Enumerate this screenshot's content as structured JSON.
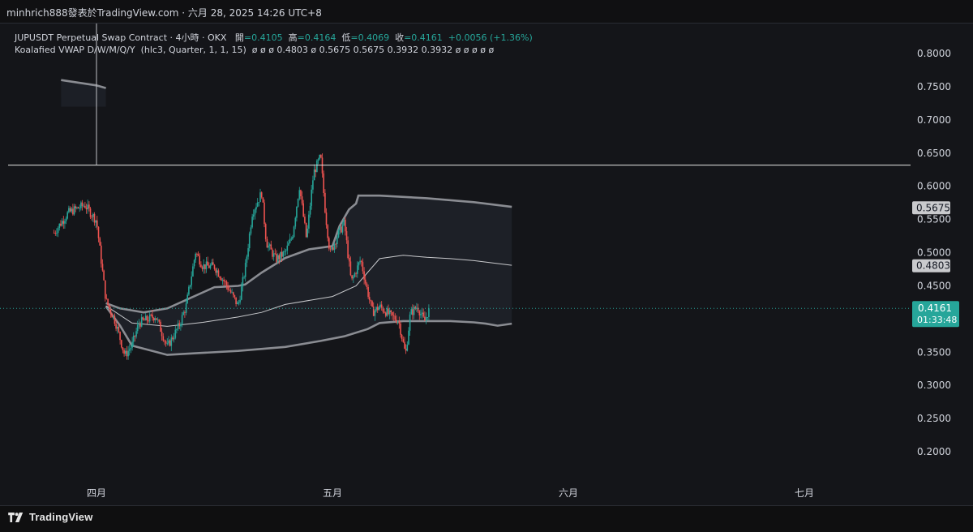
{
  "header": {
    "author_line": "minhrich888發表於TradingView.com · 六月 28, 2025 14:26 UTC+8"
  },
  "legend": {
    "symbol": "JUPUSDT Perpetual Swap Contract · 4小時 · OKX",
    "open_label": "開",
    "open_value": "=0.4105",
    "high_label": "高",
    "high_value": "=0.4164",
    "low_label": "低",
    "low_value": "=0.4069",
    "close_label": "收",
    "close_value": "=0.4161",
    "change": "+0.0056 (+1.36%)",
    "indicator_name": "Koalafied VWAP D/W/M/Q/Y",
    "indicator_params": "(hlc3, Quarter, 1, 1, 15)",
    "indicator_values": "ø ø ø 0.4803 ø 0.5675 0.5675 0.3932 0.3932 ø ø ø ø ø"
  },
  "footer": {
    "brand": "TradingView"
  },
  "colors": {
    "up": "#26a69a",
    "down": "#ef5350",
    "band": "#8a8c92",
    "vwap": "#c8c9cc",
    "horizontal_line": "#e6e6e6",
    "price_tag": "#26a69a",
    "label_bg": "#c9cacd"
  },
  "chart_data": {
    "type": "candlestick",
    "y_axis": {
      "ticks": [
        "0.8000",
        "0.7500",
        "0.7000",
        "0.6500",
        "0.6000",
        "0.5500",
        "0.5000",
        "0.4500",
        "0.4000",
        "0.3500",
        "0.3000",
        "0.2500",
        "0.2000"
      ],
      "range": [
        0.18,
        0.84
      ],
      "scale": "linear"
    },
    "x_axis": {
      "labels": [
        "四月",
        "五月",
        "六月",
        "七月"
      ]
    },
    "price_tags": [
      {
        "value": "0.5675",
        "style": "grey"
      },
      {
        "value": "0.4803",
        "style": "grey"
      },
      {
        "value": "0.4161",
        "countdown": "01:33:48",
        "style": "green"
      }
    ],
    "horizontal_line": 0.6318,
    "vertical_line_month": "四月",
    "current_price": 0.4161,
    "vwap_bands": {
      "previous_upper": [
        [
          -0.15,
          0.76
        ],
        [
          0.0,
          0.752
        ],
        [
          0.04,
          0.748
        ]
      ],
      "upper": [
        [
          0.04,
          0.424
        ],
        [
          0.1,
          0.416
        ],
        [
          0.2,
          0.41
        ],
        [
          0.3,
          0.416
        ],
        [
          0.4,
          0.432
        ],
        [
          0.5,
          0.448
        ],
        [
          0.55,
          0.449
        ],
        [
          0.6,
          0.45
        ],
        [
          0.63,
          0.452
        ],
        [
          0.7,
          0.47
        ],
        [
          0.8,
          0.492
        ],
        [
          0.9,
          0.505
        ],
        [
          1.0,
          0.51
        ],
        [
          1.03,
          0.54
        ],
        [
          1.07,
          0.565
        ],
        [
          1.1,
          0.574
        ],
        [
          1.11,
          0.586
        ],
        [
          1.2,
          0.586
        ],
        [
          1.4,
          0.582
        ],
        [
          1.6,
          0.576
        ],
        [
          1.76,
          0.569
        ]
      ],
      "vwap": [
        [
          0.04,
          0.42
        ],
        [
          0.15,
          0.394
        ],
        [
          0.3,
          0.389
        ],
        [
          0.45,
          0.395
        ],
        [
          0.6,
          0.403
        ],
        [
          0.7,
          0.41
        ],
        [
          0.8,
          0.422
        ],
        [
          1.0,
          0.434
        ],
        [
          1.1,
          0.45
        ],
        [
          1.2,
          0.491
        ],
        [
          1.3,
          0.496
        ],
        [
          1.4,
          0.493
        ],
        [
          1.5,
          0.491
        ],
        [
          1.6,
          0.488
        ],
        [
          1.76,
          0.481
        ]
      ],
      "lower": [
        [
          0.04,
          0.419
        ],
        [
          0.1,
          0.39
        ],
        [
          0.15,
          0.36
        ],
        [
          0.3,
          0.346
        ],
        [
          0.45,
          0.349
        ],
        [
          0.6,
          0.352
        ],
        [
          0.8,
          0.358
        ],
        [
          0.95,
          0.367
        ],
        [
          1.05,
          0.374
        ],
        [
          1.15,
          0.385
        ],
        [
          1.2,
          0.394
        ],
        [
          1.3,
          0.397
        ],
        [
          1.5,
          0.397
        ],
        [
          1.6,
          0.395
        ],
        [
          1.65,
          0.393
        ],
        [
          1.7,
          0.39
        ],
        [
          1.76,
          0.393
        ]
      ]
    },
    "close_path": [
      [
        -0.18,
        0.53
      ],
      [
        -0.12,
        0.56
      ],
      [
        -0.05,
        0.572
      ],
      [
        0.0,
        0.548
      ],
      [
        0.04,
        0.428
      ],
      [
        0.08,
        0.396
      ],
      [
        0.12,
        0.345
      ],
      [
        0.15,
        0.36
      ],
      [
        0.18,
        0.394
      ],
      [
        0.25,
        0.405
      ],
      [
        0.3,
        0.358
      ],
      [
        0.35,
        0.39
      ],
      [
        0.38,
        0.42
      ],
      [
        0.42,
        0.501
      ],
      [
        0.45,
        0.48
      ],
      [
        0.5,
        0.479
      ],
      [
        0.55,
        0.452
      ],
      [
        0.6,
        0.42
      ],
      [
        0.63,
        0.475
      ],
      [
        0.66,
        0.56
      ],
      [
        0.7,
        0.59
      ],
      [
        0.72,
        0.515
      ],
      [
        0.76,
        0.49
      ],
      [
        0.8,
        0.5
      ],
      [
        0.83,
        0.525
      ],
      [
        0.86,
        0.6
      ],
      [
        0.89,
        0.52
      ],
      [
        0.92,
        0.62
      ],
      [
        0.95,
        0.645
      ],
      [
        0.97,
        0.56
      ],
      [
        0.99,
        0.498
      ],
      [
        1.02,
        0.525
      ],
      [
        1.05,
        0.545
      ],
      [
        1.08,
        0.455
      ],
      [
        1.1,
        0.473
      ],
      [
        1.12,
        0.49
      ],
      [
        1.14,
        0.455
      ],
      [
        1.17,
        0.41
      ],
      [
        1.2,
        0.419
      ],
      [
        1.25,
        0.404
      ],
      [
        1.28,
        0.398
      ],
      [
        1.31,
        0.346
      ],
      [
        1.33,
        0.408
      ],
      [
        1.36,
        0.419
      ],
      [
        1.39,
        0.396
      ],
      [
        1.41,
        0.4161
      ]
    ]
  }
}
